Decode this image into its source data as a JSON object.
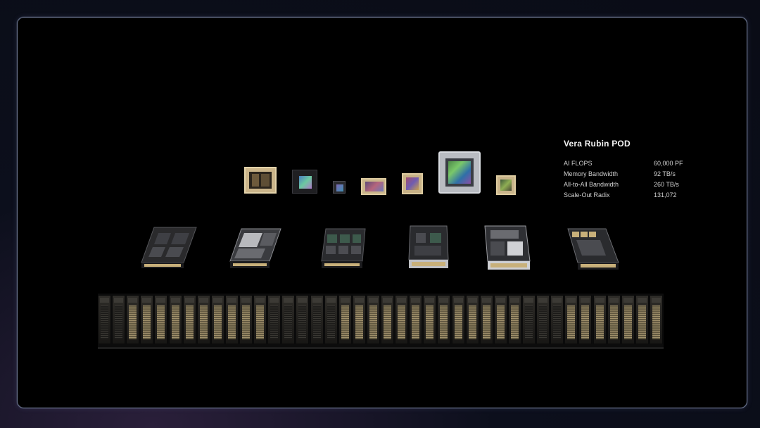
{
  "specs": {
    "title": "Vera Rubin POD",
    "rows": [
      {
        "label": "AI FLOPS",
        "value": "60,000 PF"
      },
      {
        "label": "Memory Bandwidth",
        "value": "92 TB/s"
      },
      {
        "label": "All-to-All Bandwidth",
        "value": "260 TB/s"
      },
      {
        "label": "Scale-Out Radix",
        "value": "131,072"
      }
    ]
  },
  "colors": {
    "gold": "#c8b07a",
    "frame_border": "#6b7590",
    "background": "#000000"
  }
}
